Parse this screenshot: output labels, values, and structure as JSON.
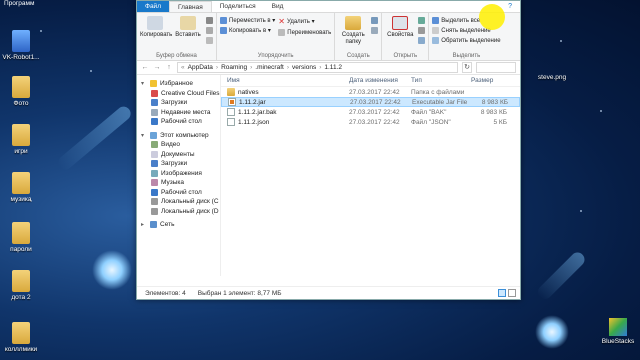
{
  "desktop": {
    "top_label": "Программ",
    "icons": [
      "VK-Robot1...",
      "Фото",
      "игри",
      "музика",
      "пароли",
      "дота 2",
      "колллмики"
    ],
    "right_icons": [
      "steve.png",
      "BlueStacks"
    ]
  },
  "ribbon": {
    "tabs": [
      "Файл",
      "Главная",
      "Поделиться",
      "Вид"
    ],
    "clipboard": {
      "copy": "Копировать",
      "paste": "Вставить",
      "label": "Буфер обмена"
    },
    "organize": {
      "move": "Переместить в ▾",
      "copy_to": "Копировать в ▾",
      "delete": "Удалить ▾",
      "rename": "Переименовать",
      "label": "Упорядочить"
    },
    "create": {
      "new_folder": "Создать папку",
      "label": "Создать"
    },
    "open": {
      "properties": "Свойства",
      "label": "Открыть"
    },
    "select": {
      "all": "Выделить все",
      "none": "Снять выделение",
      "invert": "Обратить выделение",
      "label": "Выделить"
    }
  },
  "address": {
    "crumbs": [
      "AppData",
      "Roaming",
      ".minecraft",
      "versions",
      "1.11.2"
    ]
  },
  "nav": {
    "favorites": "Избранное",
    "fav_items": [
      "Creative Cloud Files",
      "Загрузки",
      "Недавние места",
      "Рабочий стол"
    ],
    "computer": "Этот компьютер",
    "comp_items": [
      "Видео",
      "Документы",
      "Загрузки",
      "Изображения",
      "Музыка",
      "Рабочий стол",
      "Локальный диск (C",
      "Локальный диск (D"
    ],
    "network": "Сеть"
  },
  "files": {
    "headers": [
      "Имя",
      "Дата изменения",
      "Тип",
      "Размер"
    ],
    "rows": [
      {
        "name": "natives",
        "date": "27.03.2017 22:42",
        "type": "Папка с файлами",
        "size": "",
        "icon": "folder"
      },
      {
        "name": "1.11.2.jar",
        "date": "27.03.2017 22:42",
        "type": "Executable Jar File",
        "size": "8 983 КБ",
        "icon": "jar"
      },
      {
        "name": "1.11.2.jar.bak",
        "date": "27.03.2017 22:42",
        "type": "Файл \"BAK\"",
        "size": "8 983 КБ",
        "icon": "doc"
      },
      {
        "name": "1.11.2.json",
        "date": "27.03.2017 22:42",
        "type": "Файл \"JSON\"",
        "size": "5 КБ",
        "icon": "doc"
      }
    ]
  },
  "status": {
    "count": "Элементов: 4",
    "selected": "Выбран 1 элемент: 8,77 МБ"
  },
  "colors": {
    "accent": "#1979ca",
    "selection": "#cce8ff"
  }
}
